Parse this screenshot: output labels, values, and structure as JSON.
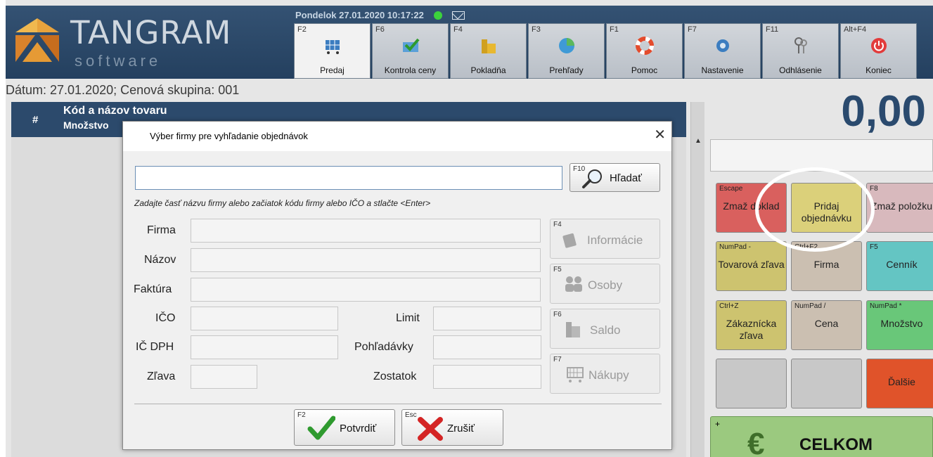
{
  "header": {
    "brand_name": "TANGRAM",
    "brand_sub": "software",
    "datetime": "Pondelok 27.01.2020 10:17:22",
    "menu": [
      {
        "key": "F2",
        "label": "Predaj",
        "icon": "cart-icon"
      },
      {
        "key": "F6",
        "label": "Kontrola ceny",
        "icon": "price-check-icon"
      },
      {
        "key": "F4",
        "label": "Pokladňa",
        "icon": "cash-register-icon"
      },
      {
        "key": "F3",
        "label": "Prehľady",
        "icon": "pie-chart-icon"
      },
      {
        "key": "F1",
        "label": "Pomoc",
        "icon": "lifebuoy-icon"
      },
      {
        "key": "F7",
        "label": "Nastavenie",
        "icon": "gear-icon"
      },
      {
        "key": "F11",
        "label": "Odhlásenie",
        "icon": "keys-icon"
      },
      {
        "key": "Alt+F4",
        "label": "Koniec",
        "icon": "power-icon"
      }
    ]
  },
  "main": {
    "info_line": "Dátum: 27.01.2020; Cenová skupina: 001",
    "grid_header": {
      "hash": "#",
      "code": "Kód a názov tovaru",
      "qty": "Množstvo"
    }
  },
  "right_panel": {
    "total": "0,00",
    "tiles": [
      {
        "key": "Escape",
        "label": "Zmaž doklad",
        "color": "#d9605e"
      },
      {
        "key": "",
        "label": "Pridaj objednávku",
        "color": "#dbd07a"
      },
      {
        "key": "F8",
        "label": "Zmaž položku",
        "color": "#d8b9bd"
      },
      {
        "key": "NumPad -",
        "label": "Tovarová zľava",
        "color": "#cdc36f"
      },
      {
        "key": "Ctrl+F2",
        "label": "Firma",
        "color": "#cbbfb1"
      },
      {
        "key": "F5",
        "label": "Cenník",
        "color": "#64c5c3"
      },
      {
        "key": "Ctrl+Z",
        "label": "Zákaznícka zľava",
        "color": "#cdc36f"
      },
      {
        "key": "NumPad /",
        "label": "Cena",
        "color": "#cbbfb1"
      },
      {
        "key": "NumPad *",
        "label": "Množstvo",
        "color": "#69c779"
      },
      {
        "key": "",
        "label": "",
        "color": "#c8c8c8"
      },
      {
        "key": "",
        "label": "",
        "color": "#c8c8c8"
      },
      {
        "key": "",
        "label": "Ďalšie",
        "color": "#e0532a"
      }
    ],
    "celkom": {
      "key": "+",
      "symbol": "€",
      "label": "CELKOM"
    }
  },
  "dialog": {
    "title": "Výber firmy pre vyhľadanie objednávok",
    "close": "✕",
    "search_value": "",
    "search_button": {
      "key": "F10",
      "label": "Hľadať"
    },
    "hint": "Zadajte časť názvu firmy alebo začiatok kódu firmy alebo IČO a stlačte <Enter>",
    "labels": {
      "firma": "Firma",
      "nazov": "Názov",
      "faktura": "Faktúra",
      "ico": "IČO",
      "icdph": "IČ DPH",
      "zlava": "Zľava",
      "limit": "Limit",
      "pohladavky": "Pohľadávky",
      "zostatok": "Zostatok"
    },
    "side_buttons": [
      {
        "key": "F4",
        "label": "Informácie"
      },
      {
        "key": "F5",
        "label": "Osoby"
      },
      {
        "key": "F6",
        "label": "Saldo"
      },
      {
        "key": "F7",
        "label": "Nákupy"
      }
    ],
    "confirm": {
      "key": "F2",
      "label": "Potvrdiť"
    },
    "cancel": {
      "key": "Esc",
      "label": "Zrušiť"
    }
  }
}
